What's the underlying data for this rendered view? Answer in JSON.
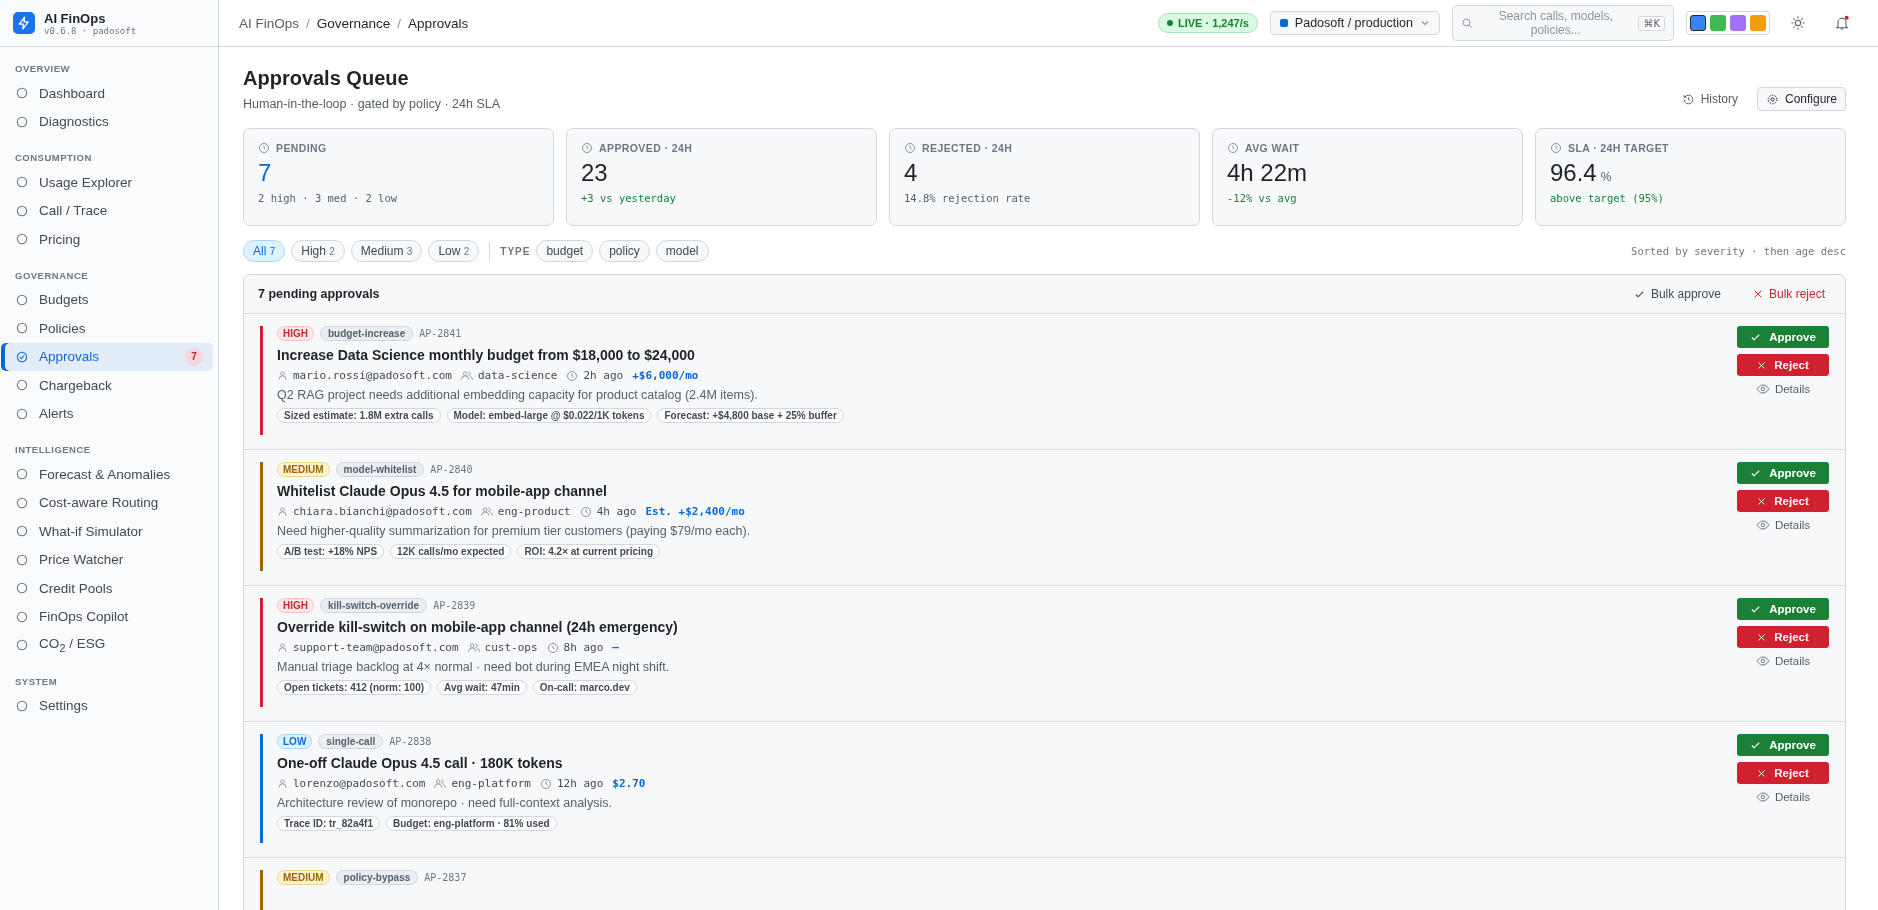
{
  "brand": {
    "name": "AI FinOps",
    "version": "v0.6.8 · padosoft"
  },
  "sidebar": {
    "sections": [
      {
        "title": "OVERVIEW",
        "items": [
          {
            "label": "Dashboard",
            "selected": false
          },
          {
            "label": "Diagnostics",
            "selected": false
          }
        ]
      },
      {
        "title": "CONSUMPTION",
        "items": [
          {
            "label": "Usage Explorer",
            "selected": false
          },
          {
            "label": "Call / Trace",
            "selected": false
          },
          {
            "label": "Pricing",
            "selected": false
          }
        ]
      },
      {
        "title": "GOVERNANCE",
        "items": [
          {
            "label": "Budgets",
            "selected": false
          },
          {
            "label": "Policies",
            "selected": false
          },
          {
            "label": "Approvals",
            "selected": true,
            "badge": "7"
          },
          {
            "label": "Chargeback",
            "selected": false
          },
          {
            "label": "Alerts",
            "selected": false
          }
        ]
      },
      {
        "title": "INTELLIGENCE",
        "items": [
          {
            "label": "Forecast & Anomalies",
            "selected": false
          },
          {
            "label": "Cost-aware Routing",
            "selected": false
          },
          {
            "label": "What-if Simulator",
            "selected": false
          },
          {
            "label": "Price Watcher",
            "selected": false
          },
          {
            "label": "Credit Pools",
            "selected": false
          },
          {
            "label": "FinOps Copilot",
            "selected": false
          },
          {
            "label": "CO$_{2}$ / ESG",
            "selected": false
          }
        ]
      },
      {
        "title": "SYSTEM",
        "items": [
          {
            "label": "Settings",
            "selected": false
          }
        ]
      }
    ]
  },
  "header": {
    "breadcrumb": [
      "AI FinOps",
      "Governance",
      "Approvals"
    ],
    "breadcrumb_separator": "/",
    "live": "LIVE · 1,247/s",
    "workspace": "Padosoft / production",
    "search": {
      "placeholder": "Search calls, models, policies...",
      "shortcut": "⌘K"
    },
    "swatches": [
      {
        "color": "#3b82f6",
        "selected": true
      },
      {
        "color": "#3fb950",
        "selected": false
      },
      {
        "color": "#a371f7",
        "selected": false
      },
      {
        "color": "#f59e0b",
        "selected": false
      }
    ],
    "notifications": true
  },
  "page": {
    "title": "Approvals Queue",
    "subtitle": "Human-in-the-loop · gated by policy · 24h SLA",
    "actions": [
      "History",
      "Configure"
    ]
  },
  "stats": [
    {
      "label": "PENDING",
      "value": "7",
      "highlight": true,
      "sub": "2 high · 3 med · 2 low",
      "positive": false
    },
    {
      "label": "APPROVED · 24H",
      "value": "23",
      "highlight": false,
      "sub": "+3 vs yesterday",
      "positive": true
    },
    {
      "label": "REJECTED · 24H",
      "value": "4",
      "highlight": false,
      "sub": "14.8% rejection rate",
      "positive": false
    },
    {
      "label": "AVG WAIT",
      "value": "4h 22m",
      "highlight": false,
      "sub": "-12% vs avg",
      "positive": true
    },
    {
      "label": "SLA · 24H TARGET",
      "value": "96.4",
      "unit": "%",
      "highlight": false,
      "sub": "above target (95%)",
      "positive": true
    }
  ],
  "filters": {
    "severity": [
      {
        "label": "All",
        "count": "7",
        "selected": true
      },
      {
        "label": "High",
        "count": "2",
        "selected": false
      },
      {
        "label": "Medium",
        "count": "3",
        "selected": false
      },
      {
        "label": "Low",
        "count": "2",
        "selected": false
      }
    ],
    "type_label": "TYPE",
    "types": [
      {
        "label": "budget",
        "selected": false
      },
      {
        "label": "policy",
        "selected": false
      },
      {
        "label": "model",
        "selected": false
      }
    ],
    "sort": "Sorted by severity · then age desc"
  },
  "queue": {
    "title": "7 pending approvals",
    "bulk_approve": "Bulk approve",
    "bulk_reject": "Bulk reject",
    "items": [
      {
        "severity": {
          "kind": "high",
          "label": "HIGH"
        },
        "type": "budget-increase",
        "id": "AP-2841",
        "title": "Increase Data Science monthly budget from $18,000 to $24,000",
        "requester": "mario.rossi@padosoft.com",
        "team": "data-science",
        "age": "2h ago",
        "cost": "+$6,000/mo",
        "description": "Q2 RAG project needs additional embedding capacity for product catalog (2.4M items).",
        "tags": [
          "Sized estimate: 1.8M extra calls",
          "Model: embed-large @ $0.022/1K tokens",
          "Forecast: +$4,800 base + 25% buffer"
        ],
        "actions": {
          "approve": "Approve",
          "reject": "Reject",
          "details": "Details"
        }
      },
      {
        "severity": {
          "kind": "medium",
          "label": "MEDIUM"
        },
        "type": "model-whitelist",
        "id": "AP-2840",
        "title": "Whitelist Claude Opus 4.5 for mobile-app channel",
        "requester": "chiara.bianchi@padosoft.com",
        "team": "eng-product",
        "age": "4h ago",
        "cost": "Est. +$2,400/mo",
        "description": "Need higher-quality summarization for premium tier customers (paying $79/mo each).",
        "tags": [
          "A/B test: +18% NPS",
          "12K calls/mo expected",
          "ROI: 4.2× at current pricing"
        ],
        "actions": {
          "approve": "Approve",
          "reject": "Reject",
          "details": "Details"
        }
      },
      {
        "severity": {
          "kind": "high",
          "label": "HIGH"
        },
        "type": "kill-switch-override",
        "id": "AP-2839",
        "title": "Override kill-switch on mobile-app channel (24h emergency)",
        "requester": "support-team@padosoft.com",
        "team": "cust-ops",
        "age": "8h ago",
        "cost": "—",
        "description": "Manual triage backlog at 4× normal · need bot during EMEA night shift.",
        "tags": [
          "Open tickets: 412 (norm: 100)",
          "Avg wait: 47min",
          "On-call: marco.dev"
        ],
        "actions": {
          "approve": "Approve",
          "reject": "Reject",
          "details": "Details"
        }
      },
      {
        "severity": {
          "kind": "low",
          "label": "LOW"
        },
        "type": "single-call",
        "id": "AP-2838",
        "title": "One-off Claude Opus 4.5 call · 180K tokens",
        "requester": "lorenzo@padosoft.com",
        "team": "eng-platform",
        "age": "12h ago",
        "cost": "$2.70",
        "description": "Architecture review of monorepo · need full-context analysis.",
        "tags": [
          "Trace ID: tr_82a4f1",
          "Budget: eng-platform · 81% used"
        ],
        "actions": {
          "approve": "Approve",
          "reject": "Reject",
          "details": "Details"
        }
      },
      {
        "severity": {
          "kind": "medium",
          "label": "MEDIUM"
        },
        "type": "policy-bypass",
        "id": "AP-2837"
      }
    ]
  }
}
